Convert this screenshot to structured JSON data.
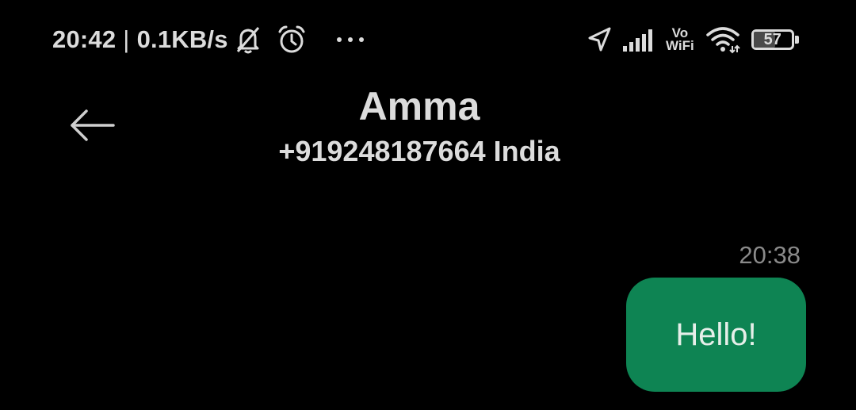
{
  "status_bar": {
    "time": "20:42",
    "separator": "|",
    "network_speed": "0.1KB/s",
    "battery_level": "57",
    "battery_percent": 57,
    "vowifi_top": "Vo",
    "vowifi_bottom": "WiFi",
    "icons": [
      "bell-muted-icon",
      "alarm-clock-icon",
      "more-dots-icon",
      "location-arrow-icon",
      "signal-bars-icon",
      "vowifi-icon",
      "wifi-icon",
      "battery-icon"
    ]
  },
  "header": {
    "back_icon": "arrow-left-icon",
    "contact_name": "Amma",
    "contact_number": "+919248187664 India"
  },
  "messages": [
    {
      "time": "20:38",
      "text": "Hello!",
      "direction": "outgoing",
      "bubble_color": "#0e8453"
    }
  ],
  "colors": {
    "background": "#000000",
    "text": "#dcdcdc",
    "timestamp": "#8a8a8a",
    "bubble": "#0e8453"
  }
}
